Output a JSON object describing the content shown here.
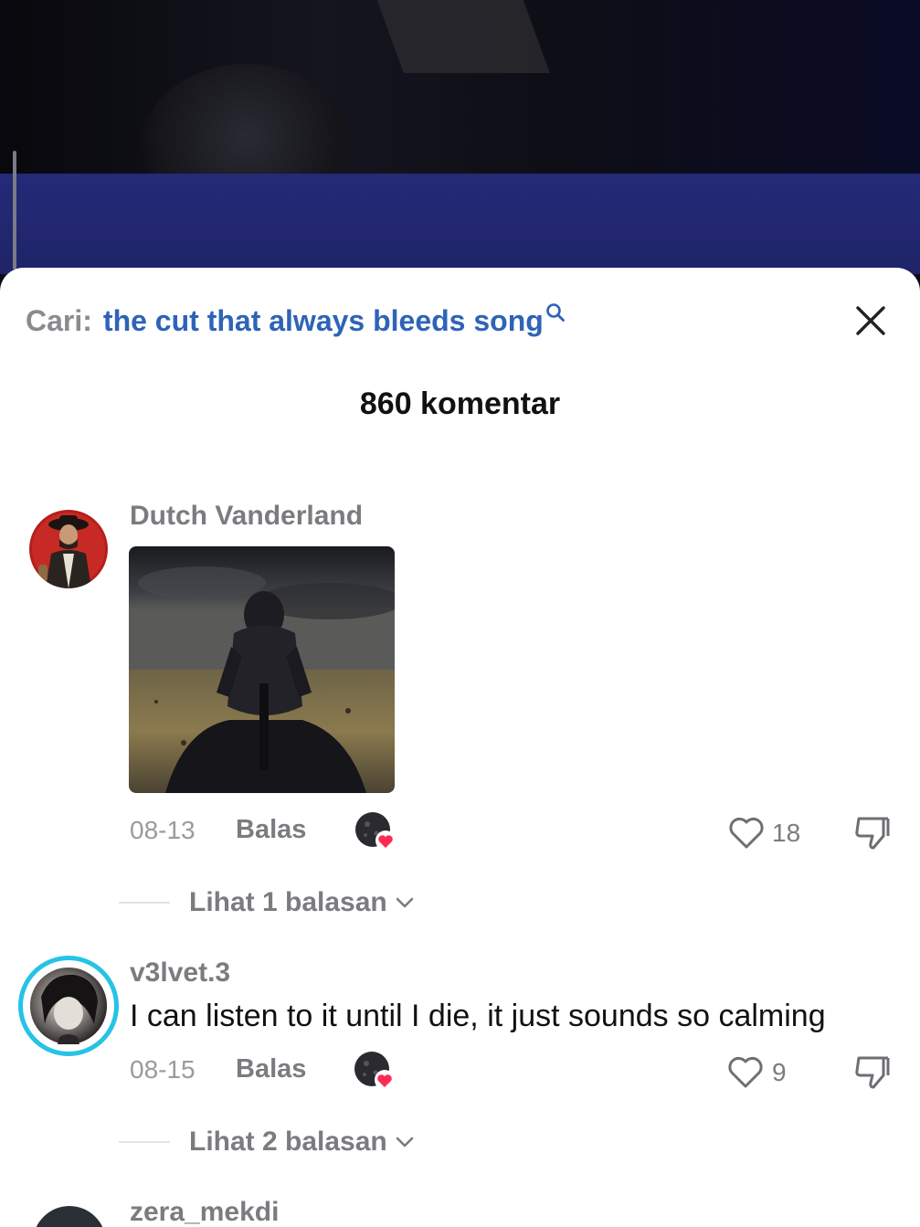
{
  "search": {
    "prefix": "Cari:",
    "query": "the cut that always bleeds song"
  },
  "header": {
    "comment_count": "860 komentar"
  },
  "comments": [
    {
      "username": "Dutch Vanderland",
      "has_image": true,
      "date": "08-13",
      "reply_label": "Balas",
      "likes": "18",
      "view_replies": "Lihat 1 balasan"
    },
    {
      "username": "v3lvet.3",
      "text": "I can listen to it until I die, it just sounds so calming",
      "date": "08-15",
      "reply_label": "Balas",
      "likes": "9",
      "view_replies": "Lihat 2 balasan"
    },
    {
      "username": "zera_mekdi"
    }
  ],
  "colors": {
    "accent_link": "#2e63b8",
    "like_heart": "#fe2c55",
    "story_ring": "#25c3e6"
  },
  "icons": [
    "search-icon",
    "close-icon",
    "heart-icon",
    "dislike-icon",
    "chevron-down-icon",
    "creator-liked-icon"
  ]
}
